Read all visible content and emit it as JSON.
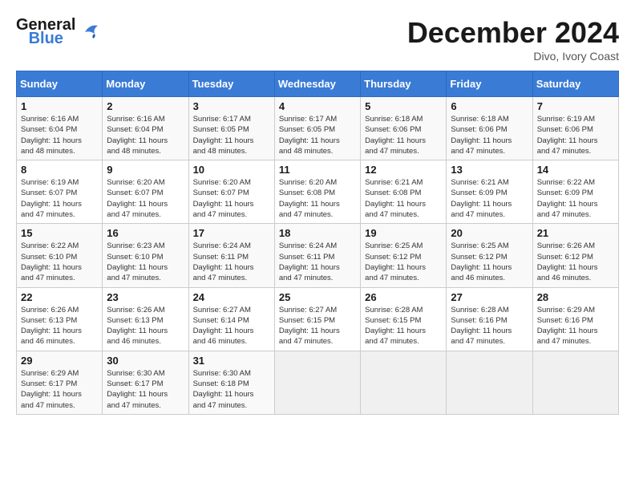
{
  "header": {
    "logo_general": "General",
    "logo_blue": "Blue",
    "month": "December 2024",
    "location": "Divo, Ivory Coast"
  },
  "weekdays": [
    "Sunday",
    "Monday",
    "Tuesday",
    "Wednesday",
    "Thursday",
    "Friday",
    "Saturday"
  ],
  "weeks": [
    [
      {
        "day": "1",
        "info": "Sunrise: 6:16 AM\nSunset: 6:04 PM\nDaylight: 11 hours\nand 48 minutes."
      },
      {
        "day": "2",
        "info": "Sunrise: 6:16 AM\nSunset: 6:04 PM\nDaylight: 11 hours\nand 48 minutes."
      },
      {
        "day": "3",
        "info": "Sunrise: 6:17 AM\nSunset: 6:05 PM\nDaylight: 11 hours\nand 48 minutes."
      },
      {
        "day": "4",
        "info": "Sunrise: 6:17 AM\nSunset: 6:05 PM\nDaylight: 11 hours\nand 48 minutes."
      },
      {
        "day": "5",
        "info": "Sunrise: 6:18 AM\nSunset: 6:06 PM\nDaylight: 11 hours\nand 47 minutes."
      },
      {
        "day": "6",
        "info": "Sunrise: 6:18 AM\nSunset: 6:06 PM\nDaylight: 11 hours\nand 47 minutes."
      },
      {
        "day": "7",
        "info": "Sunrise: 6:19 AM\nSunset: 6:06 PM\nDaylight: 11 hours\nand 47 minutes."
      }
    ],
    [
      {
        "day": "8",
        "info": "Sunrise: 6:19 AM\nSunset: 6:07 PM\nDaylight: 11 hours\nand 47 minutes."
      },
      {
        "day": "9",
        "info": "Sunrise: 6:20 AM\nSunset: 6:07 PM\nDaylight: 11 hours\nand 47 minutes."
      },
      {
        "day": "10",
        "info": "Sunrise: 6:20 AM\nSunset: 6:07 PM\nDaylight: 11 hours\nand 47 minutes."
      },
      {
        "day": "11",
        "info": "Sunrise: 6:20 AM\nSunset: 6:08 PM\nDaylight: 11 hours\nand 47 minutes."
      },
      {
        "day": "12",
        "info": "Sunrise: 6:21 AM\nSunset: 6:08 PM\nDaylight: 11 hours\nand 47 minutes."
      },
      {
        "day": "13",
        "info": "Sunrise: 6:21 AM\nSunset: 6:09 PM\nDaylight: 11 hours\nand 47 minutes."
      },
      {
        "day": "14",
        "info": "Sunrise: 6:22 AM\nSunset: 6:09 PM\nDaylight: 11 hours\nand 47 minutes."
      }
    ],
    [
      {
        "day": "15",
        "info": "Sunrise: 6:22 AM\nSunset: 6:10 PM\nDaylight: 11 hours\nand 47 minutes."
      },
      {
        "day": "16",
        "info": "Sunrise: 6:23 AM\nSunset: 6:10 PM\nDaylight: 11 hours\nand 47 minutes."
      },
      {
        "day": "17",
        "info": "Sunrise: 6:24 AM\nSunset: 6:11 PM\nDaylight: 11 hours\nand 47 minutes."
      },
      {
        "day": "18",
        "info": "Sunrise: 6:24 AM\nSunset: 6:11 PM\nDaylight: 11 hours\nand 47 minutes."
      },
      {
        "day": "19",
        "info": "Sunrise: 6:25 AM\nSunset: 6:12 PM\nDaylight: 11 hours\nand 47 minutes."
      },
      {
        "day": "20",
        "info": "Sunrise: 6:25 AM\nSunset: 6:12 PM\nDaylight: 11 hours\nand 46 minutes."
      },
      {
        "day": "21",
        "info": "Sunrise: 6:26 AM\nSunset: 6:12 PM\nDaylight: 11 hours\nand 46 minutes."
      }
    ],
    [
      {
        "day": "22",
        "info": "Sunrise: 6:26 AM\nSunset: 6:13 PM\nDaylight: 11 hours\nand 46 minutes."
      },
      {
        "day": "23",
        "info": "Sunrise: 6:26 AM\nSunset: 6:13 PM\nDaylight: 11 hours\nand 46 minutes."
      },
      {
        "day": "24",
        "info": "Sunrise: 6:27 AM\nSunset: 6:14 PM\nDaylight: 11 hours\nand 46 minutes."
      },
      {
        "day": "25",
        "info": "Sunrise: 6:27 AM\nSunset: 6:15 PM\nDaylight: 11 hours\nand 47 minutes."
      },
      {
        "day": "26",
        "info": "Sunrise: 6:28 AM\nSunset: 6:15 PM\nDaylight: 11 hours\nand 47 minutes."
      },
      {
        "day": "27",
        "info": "Sunrise: 6:28 AM\nSunset: 6:16 PM\nDaylight: 11 hours\nand 47 minutes."
      },
      {
        "day": "28",
        "info": "Sunrise: 6:29 AM\nSunset: 6:16 PM\nDaylight: 11 hours\nand 47 minutes."
      }
    ],
    [
      {
        "day": "29",
        "info": "Sunrise: 6:29 AM\nSunset: 6:17 PM\nDaylight: 11 hours\nand 47 minutes."
      },
      {
        "day": "30",
        "info": "Sunrise: 6:30 AM\nSunset: 6:17 PM\nDaylight: 11 hours\nand 47 minutes."
      },
      {
        "day": "31",
        "info": "Sunrise: 6:30 AM\nSunset: 6:18 PM\nDaylight: 11 hours\nand 47 minutes."
      },
      {
        "day": "",
        "info": ""
      },
      {
        "day": "",
        "info": ""
      },
      {
        "day": "",
        "info": ""
      },
      {
        "day": "",
        "info": ""
      }
    ]
  ]
}
